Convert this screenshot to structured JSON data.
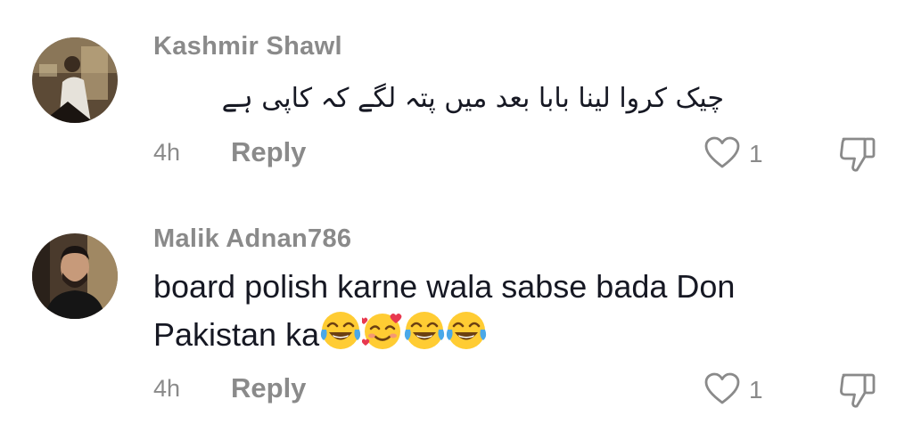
{
  "comments": [
    {
      "username": "Kashmir Shawl",
      "text": "چیک کروا لینا بابا بعد میں پتہ لگے کہ کاپی ہے",
      "time": "4h",
      "reply_label": "Reply",
      "likes": "1",
      "avatar_icon": "avatar-photo"
    },
    {
      "username": "Malik Adnan786",
      "text_line1": "board polish karne wala sabse bada Don",
      "text_line2": "Pakistan ka",
      "emojis": [
        "face-with-tears-of-joy",
        "smiling-face-with-hearts",
        "face-with-tears-of-joy",
        "face-with-tears-of-joy"
      ],
      "time": "4h",
      "reply_label": "Reply",
      "likes": "1",
      "avatar_icon": "avatar-photo"
    }
  ],
  "icons": {
    "like": "heart-outline-icon",
    "dislike": "thumbs-down-outline-icon"
  },
  "colors": {
    "text_primary": "#161823",
    "text_secondary": "#8a8a8a",
    "background": "#ffffff"
  }
}
